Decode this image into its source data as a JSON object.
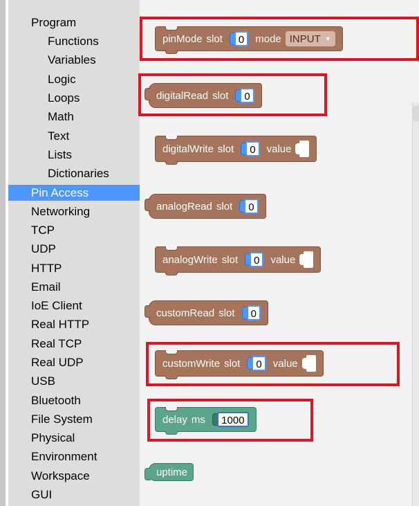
{
  "sidebar": {
    "categories": [
      {
        "label": "Program",
        "level": "top"
      },
      {
        "label": "Functions",
        "level": "sub"
      },
      {
        "label": "Variables",
        "level": "sub"
      },
      {
        "label": "Logic",
        "level": "sub"
      },
      {
        "label": "Loops",
        "level": "sub"
      },
      {
        "label": "Math",
        "level": "sub"
      },
      {
        "label": "Text",
        "level": "sub"
      },
      {
        "label": "Lists",
        "level": "sub"
      },
      {
        "label": "Dictionaries",
        "level": "sub"
      },
      {
        "label": "Pin Access",
        "level": "top",
        "selected": true
      },
      {
        "label": "Networking",
        "level": "top"
      },
      {
        "label": "TCP",
        "level": "top"
      },
      {
        "label": "UDP",
        "level": "top"
      },
      {
        "label": "HTTP",
        "level": "top"
      },
      {
        "label": "Email",
        "level": "top"
      },
      {
        "label": "IoE Client",
        "level": "top"
      },
      {
        "label": "Real HTTP",
        "level": "top"
      },
      {
        "label": "Real TCP",
        "level": "top"
      },
      {
        "label": "Real UDP",
        "level": "top"
      },
      {
        "label": "USB",
        "level": "top"
      },
      {
        "label": "Bluetooth",
        "level": "top"
      },
      {
        "label": "File System",
        "level": "top"
      },
      {
        "label": "Physical",
        "level": "top"
      },
      {
        "label": "Environment",
        "level": "top"
      },
      {
        "label": "Workspace",
        "level": "top"
      },
      {
        "label": "GUI",
        "level": "top"
      }
    ]
  },
  "blocks": {
    "pinMode": {
      "name": "pinMode",
      "slot_label": "slot",
      "slot_value": "0",
      "mode_label": "mode",
      "mode_value": "INPUT"
    },
    "digitalRead": {
      "name": "digitalRead",
      "slot_label": "slot",
      "slot_value": "0"
    },
    "digitalWrite": {
      "name": "digitalWrite",
      "slot_label": "slot",
      "slot_value": "0",
      "value_label": "value"
    },
    "analogRead": {
      "name": "analogRead",
      "slot_label": "slot",
      "slot_value": "0"
    },
    "analogWrite": {
      "name": "analogWrite",
      "slot_label": "slot",
      "slot_value": "0",
      "value_label": "value"
    },
    "customRead": {
      "name": "customRead",
      "slot_label": "slot",
      "slot_value": "0"
    },
    "customWrite": {
      "name": "customWrite",
      "slot_label": "slot",
      "slot_value": "0",
      "value_label": "value"
    },
    "delay": {
      "name": "delay",
      "ms_label": "ms",
      "ms_value": "1000"
    },
    "uptime": {
      "name": "uptime"
    }
  },
  "colors": {
    "pin_block": "#a5745b",
    "timing_block": "#5ba58c",
    "selected_category": "#4c97ff",
    "highlight": "#e0141e"
  }
}
